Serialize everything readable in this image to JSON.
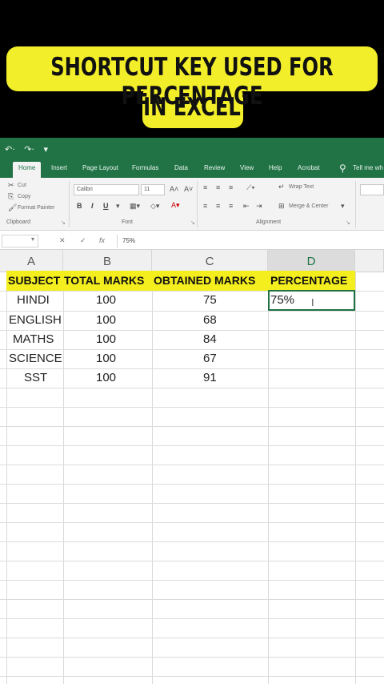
{
  "caption": {
    "line1": "SHORTCUT KEY USED FOR PERCENTAGE",
    "line2": "IN EXCEL"
  },
  "ribbon": {
    "tabs": [
      {
        "label": "Home",
        "active": true
      },
      {
        "label": "Insert"
      },
      {
        "label": "Page Layout"
      },
      {
        "label": "Formulas"
      },
      {
        "label": "Data"
      },
      {
        "label": "Review"
      },
      {
        "label": "View"
      },
      {
        "label": "Help"
      },
      {
        "label": "Acrobat"
      }
    ],
    "tell_me": "Tell me wh",
    "clipboard": {
      "cut": "Cut",
      "copy": "Copy",
      "format_painter": "Format Painter",
      "group_label": "Clipboard"
    },
    "font": {
      "name": "Calibri",
      "size": "11",
      "group_label": "Font",
      "bold": "B",
      "italic": "I",
      "underline": "U"
    },
    "alignment": {
      "wrap_text": "Wrap Text",
      "merge_center": "Merge & Center",
      "group_label": "Alignment"
    },
    "accent_color": "#217346"
  },
  "formula_bar": {
    "content": "75%"
  },
  "sheet": {
    "columns": [
      "A",
      "B",
      "C",
      "D"
    ],
    "selected_column": "D",
    "header_highlight_color": "#f4ee1e",
    "headers": {
      "a": "SUBJECT",
      "b": "TOTAL MARKS",
      "c": "OBTAINED MARKS",
      "d": "PERCENTAGE"
    },
    "rows": [
      {
        "subject": "HINDI",
        "total": "100",
        "obtained": "75"
      },
      {
        "subject": "ENGLISH",
        "total": "100",
        "obtained": "68"
      },
      {
        "subject": "MATHS",
        "total": "100",
        "obtained": "84"
      },
      {
        "subject": "SCIENCE",
        "total": "100",
        "obtained": "67"
      },
      {
        "subject": "SST",
        "total": "100",
        "obtained": "91"
      }
    ],
    "active_cell_value": "75%"
  }
}
